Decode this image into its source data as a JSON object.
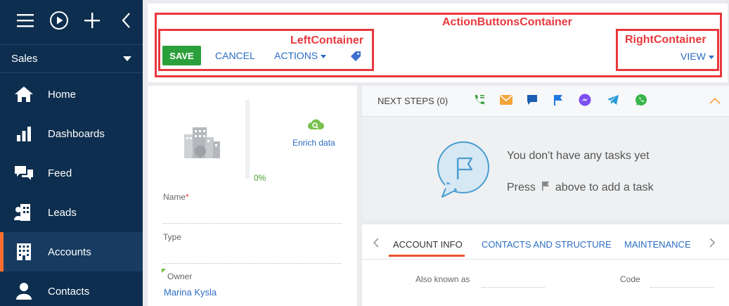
{
  "sidebar": {
    "workplace": "Sales",
    "items": [
      {
        "label": "Home",
        "icon": "home-icon"
      },
      {
        "label": "Dashboards",
        "icon": "bar-chart-icon"
      },
      {
        "label": "Feed",
        "icon": "chat-icon"
      },
      {
        "label": "Leads",
        "icon": "lead-icon"
      },
      {
        "label": "Accounts",
        "icon": "building-icon"
      },
      {
        "label": "Contacts",
        "icon": "person-icon"
      }
    ]
  },
  "toolbar": {
    "save": "SAVE",
    "cancel": "CANCEL",
    "actions": "ACTIONS",
    "view": "VIEW"
  },
  "annotations": {
    "action_buttons": "ActionButtonsContainer",
    "left": "LeftContainer",
    "right": "RightContainer"
  },
  "profile": {
    "enrich": "Enrich data",
    "progress": "0%",
    "name_label": "Name",
    "required_mark": "*",
    "type_label": "Type",
    "owner_label": "Owner",
    "owner_value": "Marina Kysla"
  },
  "next_steps": {
    "title": "NEXT STEPS (0)",
    "empty_title": "You don't have any tasks yet",
    "press": "Press",
    "above": "above to add a task"
  },
  "tabs": {
    "items": [
      "ACCOUNT INFO",
      "CONTACTS AND STRUCTURE",
      "MAINTENANCE"
    ],
    "active": 0
  },
  "account_info": {
    "also_known_as": "Also known as",
    "code": "Code"
  },
  "colors": {
    "sidebar_bg": "#0d2e4e",
    "accent_active": "#ff6d2e",
    "save_green": "#2ba03a",
    "link_blue": "#2b6cc4",
    "annotation_red": "#e8383d"
  }
}
